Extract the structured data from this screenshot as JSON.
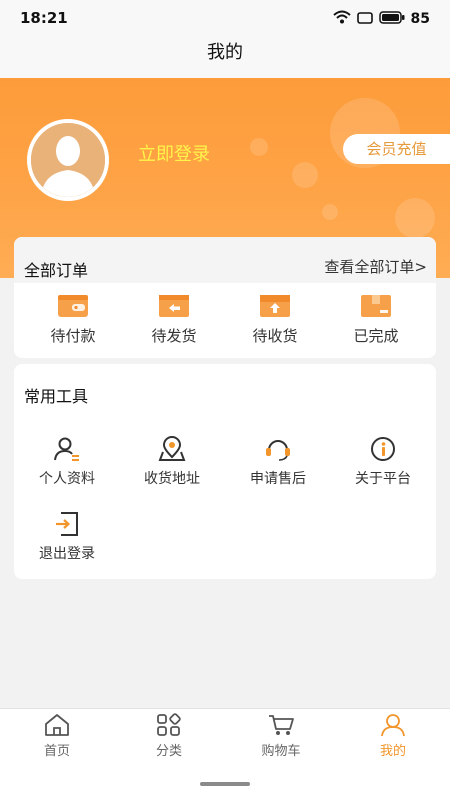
{
  "status_bar": {
    "time": "18:21",
    "battery": "85"
  },
  "nav": {
    "title": "我的"
  },
  "profile": {
    "login_text": "立即登录",
    "recharge_label": "会员充值"
  },
  "orders": {
    "title": "全部订单",
    "view_all": "查看全部订单>",
    "items": [
      {
        "label": "待付款",
        "icon": "wallet-icon"
      },
      {
        "label": "待发货",
        "icon": "ship-box-icon"
      },
      {
        "label": "待收货",
        "icon": "receive-box-icon"
      },
      {
        "label": "已完成",
        "icon": "completed-box-icon"
      }
    ]
  },
  "tools": {
    "title": "常用工具",
    "items": [
      {
        "label": "个人资料",
        "icon": "profile-icon"
      },
      {
        "label": "收货地址",
        "icon": "location-icon"
      },
      {
        "label": "申请售后",
        "icon": "headset-icon"
      },
      {
        "label": "关于平台",
        "icon": "info-icon"
      },
      {
        "label": "退出登录",
        "icon": "logout-icon"
      }
    ]
  },
  "tabbar": {
    "items": [
      {
        "label": "首页",
        "icon": "home-icon"
      },
      {
        "label": "分类",
        "icon": "category-icon"
      },
      {
        "label": "购物车",
        "icon": "cart-icon"
      },
      {
        "label": "我的",
        "icon": "user-icon",
        "active": true
      }
    ]
  },
  "colors": {
    "accent": "#f2962c",
    "hero": "#fea448",
    "login_text": "#fff44a"
  }
}
